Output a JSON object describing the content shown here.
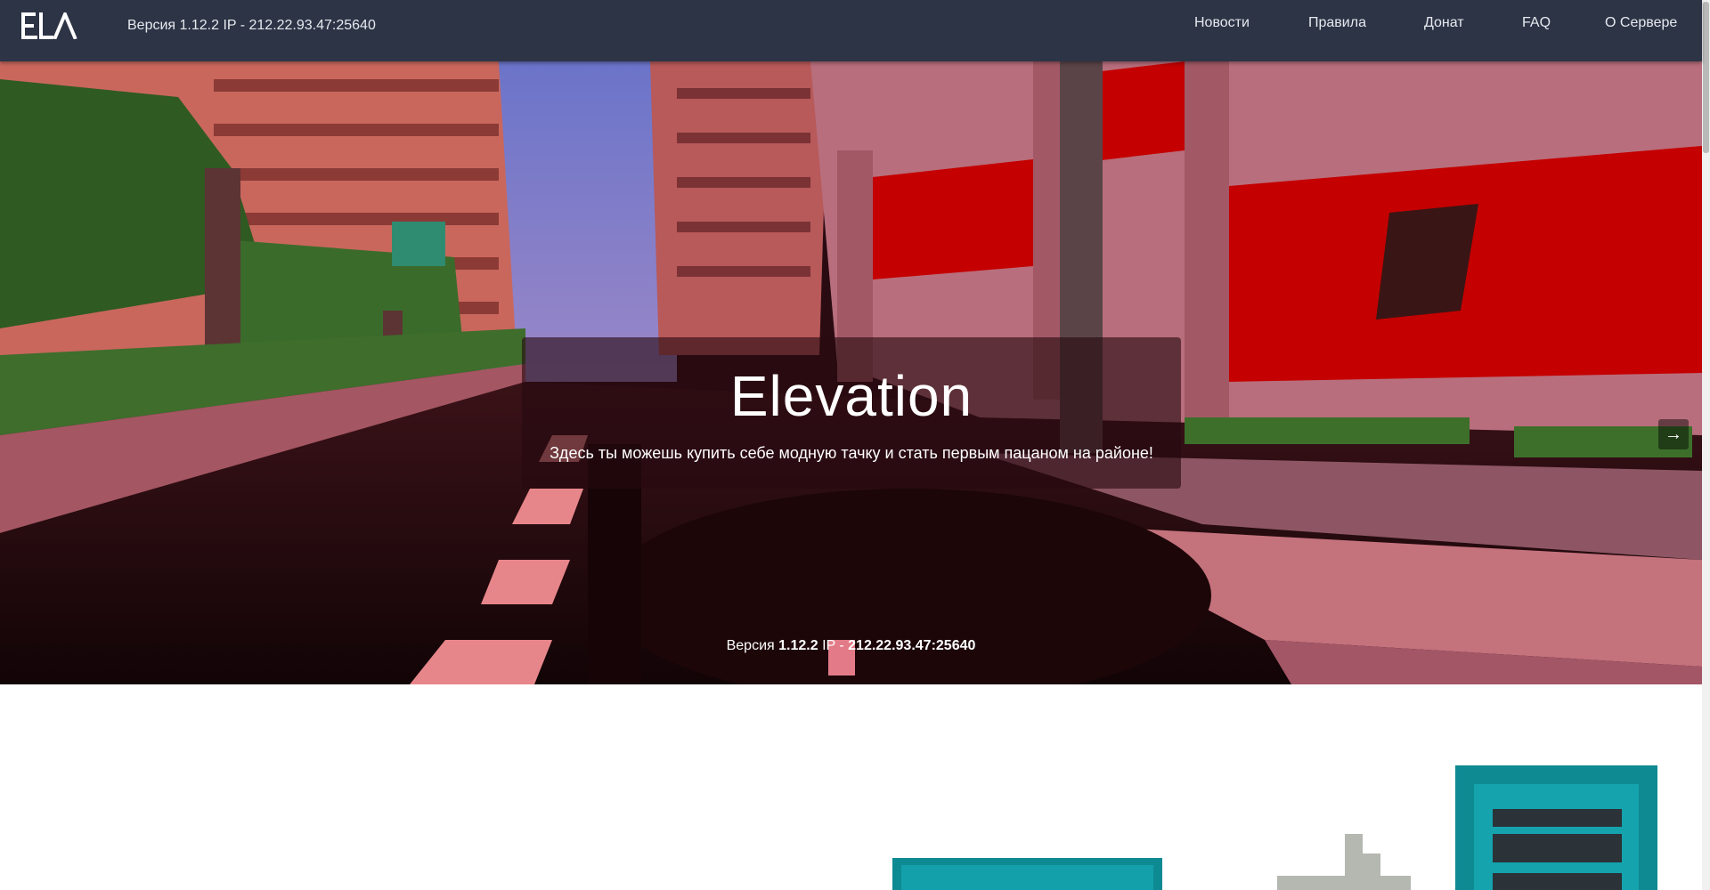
{
  "header": {
    "logo_text": "ELA",
    "server_info": "Версия 1.12.2 IP - 212.22.93.47:25640",
    "nav": [
      "Новости",
      "Правила",
      "Донат",
      "FAQ",
      "О Сервере"
    ]
  },
  "hero": {
    "title": "Elevation",
    "subtitle": "Здесь ты можешь купить себе модную тачку и стать первым пацаном на районе!",
    "next_icon": "arrow-right-icon",
    "bottom": {
      "version_label": "Версия",
      "version": "1.12.2",
      "ip_label": "IP -",
      "ip": "212.22.93.47:25640"
    }
  },
  "colors": {
    "navbar_bg": "#2d3446",
    "hero_overlay": "#260a10",
    "accent_red": "#c40000",
    "teal": "#0e8a93"
  }
}
